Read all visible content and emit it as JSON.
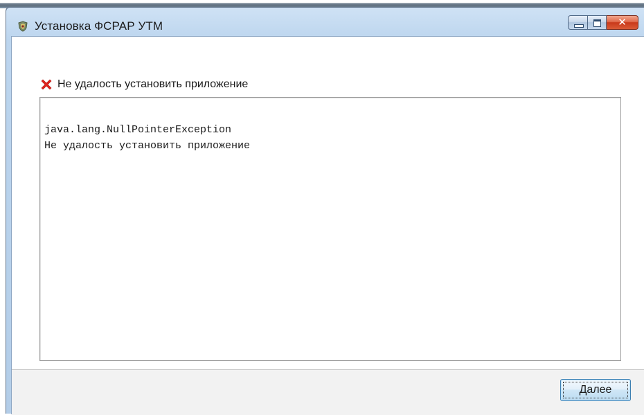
{
  "window": {
    "title": "Установка ФСРАР УТМ",
    "app_icon": "shield-crest-icon",
    "controls": {
      "minimize_icon": "minimize-icon",
      "maximize_icon": "maximize-icon",
      "close_glyph": "✕"
    }
  },
  "status": {
    "icon": "error-x-icon",
    "icon_color": "#e0241d",
    "message": "Не удалость установить приложение"
  },
  "log": {
    "lines": [
      "java.lang.NullPointerException",
      "Не удалость установить приложение"
    ]
  },
  "footer": {
    "next_label": "Далее"
  }
}
